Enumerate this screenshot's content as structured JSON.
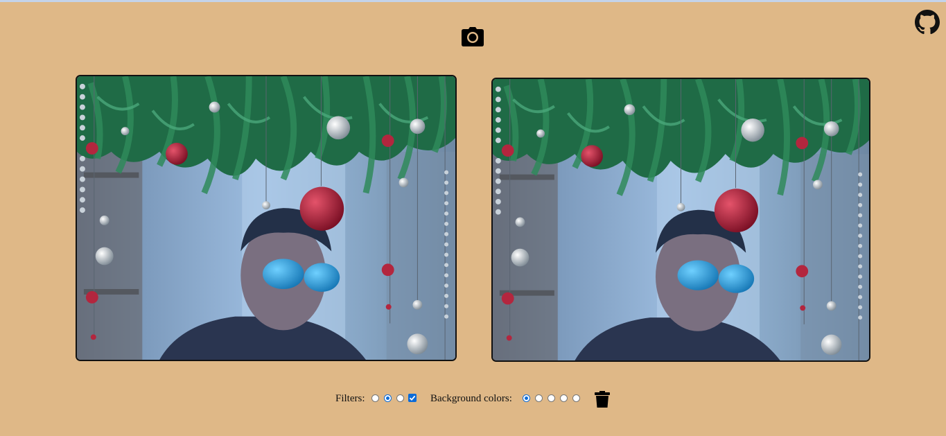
{
  "header": {
    "camera_icon": "camera-icon",
    "github_icon": "github-icon"
  },
  "controls": {
    "filters_label": "Filters:",
    "filters": [
      {
        "type": "radio",
        "checked": false
      },
      {
        "type": "radio",
        "checked": true
      },
      {
        "type": "radio",
        "checked": false
      },
      {
        "type": "checkbox",
        "checked": true
      }
    ],
    "background_label": "Background colors:",
    "background_colors": [
      {
        "checked": true
      },
      {
        "checked": false
      },
      {
        "checked": false
      },
      {
        "checked": false
      },
      {
        "checked": false
      }
    ],
    "delete_icon": "trash-icon"
  },
  "colors": {
    "page_background": "#dfb887",
    "accent": "#0b6bd8",
    "frame_border": "#111111"
  }
}
